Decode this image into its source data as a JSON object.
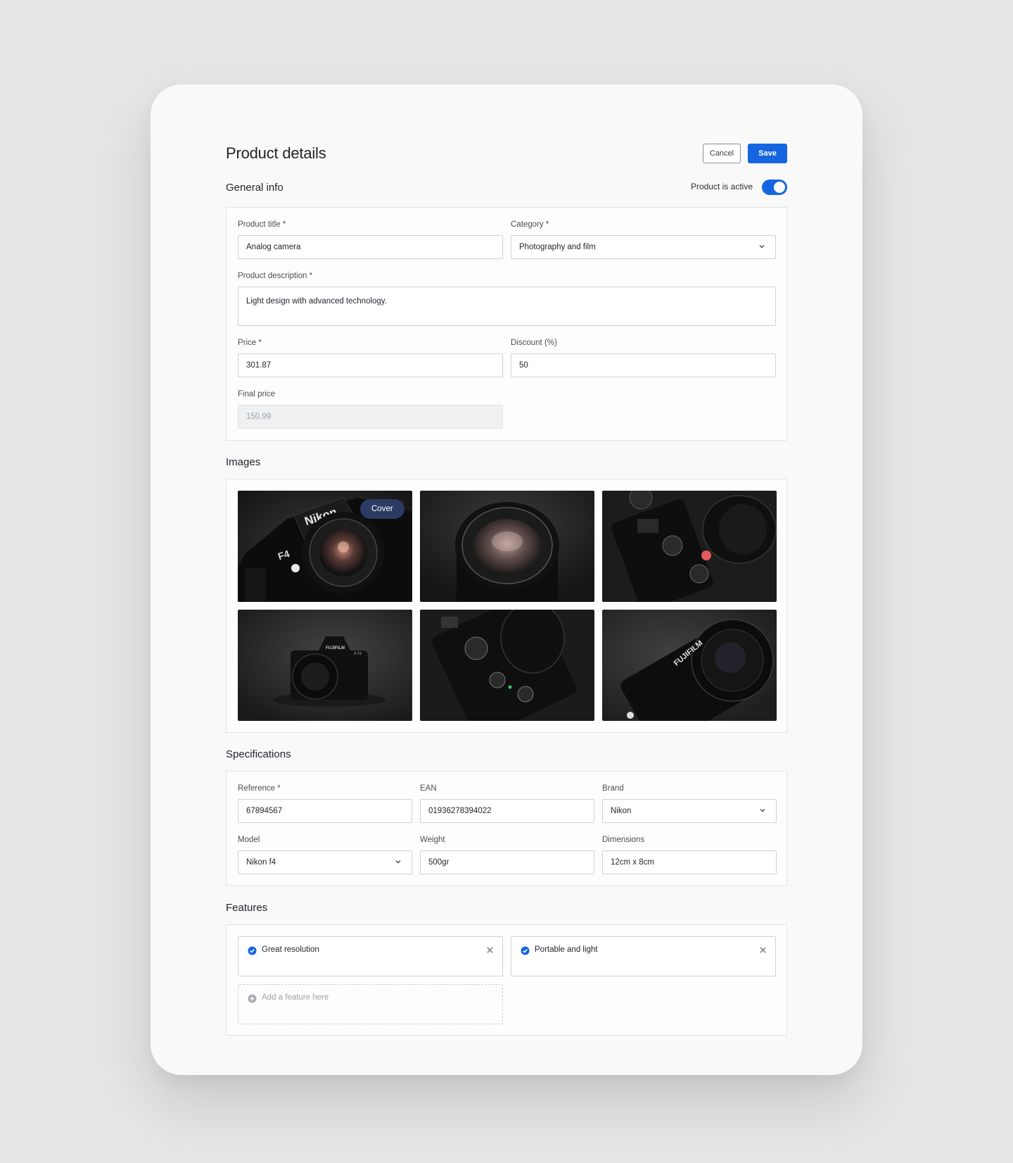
{
  "header": {
    "title": "Product details",
    "cancel_label": "Cancel",
    "save_label": "Save"
  },
  "general": {
    "title": "General info",
    "active_label": "Product is active",
    "active": true,
    "product_title_label": "Product title *",
    "product_title_value": "Analog camera",
    "category_label": "Category *",
    "category_value": "Photography and film",
    "description_label": "Product description *",
    "description_value": "Light design with advanced technology.",
    "price_label": "Price *",
    "price_value": "301.87",
    "discount_label": "Discount (%)",
    "discount_value": "50",
    "final_price_label": "Final price",
    "final_price_value": "150.99"
  },
  "images": {
    "title": "Images",
    "cover_label": "Cover",
    "tiles": [
      "camera-photo",
      "lens-photo",
      "camera-photo",
      "camera-photo",
      "camera-photo",
      "camera-photo"
    ],
    "lettering": [
      "Nikon",
      "F4",
      "FUJIFILM",
      "X-T3"
    ]
  },
  "specs": {
    "title": "Specifications",
    "reference_label": "Reference *",
    "reference_value": "67894567",
    "ean_label": "EAN",
    "ean_value": "01936278394022",
    "brand_label": "Brand",
    "brand_value": "Nikon",
    "model_label": "Model",
    "model_value": "Nikon f4",
    "weight_label": "Weight",
    "weight_value": "500gr",
    "dimensions_label": "Dimensions",
    "dimensions_value": "12cm x 8cm"
  },
  "features": {
    "title": "Features",
    "items": [
      "Great resolution",
      "Portable and light"
    ],
    "add_placeholder": "Add a feature here"
  },
  "colors": {
    "accent": "#1665e0",
    "cover_badge": "#2b3b63",
    "background": "#e4e5e7"
  },
  "icons": [
    "chevron-down-icon",
    "check-circle-icon",
    "close-icon",
    "plus-circle-icon"
  ]
}
